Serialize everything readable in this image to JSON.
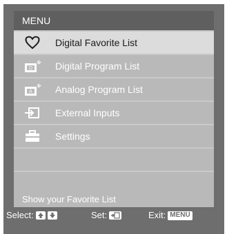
{
  "header": {
    "title": "MENU"
  },
  "menu": {
    "items": [
      {
        "label": "Digital Favorite List",
        "icon": "heart-icon",
        "selected": true
      },
      {
        "label": "Digital Program List",
        "icon": "digital-tv-icon",
        "selected": false
      },
      {
        "label": "Analog Program List",
        "icon": "analog-tv-icon",
        "selected": false
      },
      {
        "label": "External Inputs",
        "icon": "input-icon",
        "selected": false
      },
      {
        "label": "Settings",
        "icon": "toolbox-icon",
        "selected": false
      }
    ]
  },
  "help": {
    "text": "Show your Favorite List"
  },
  "footer": {
    "select_label": "Select:",
    "set_label": "Set:",
    "exit_label": "Exit:",
    "exit_key": "MENU"
  },
  "colors": {
    "frame": "#6e6e6e",
    "header": "#5f5f5f",
    "item": "#b9b9b9",
    "item_selected": "#dcdcdc"
  }
}
